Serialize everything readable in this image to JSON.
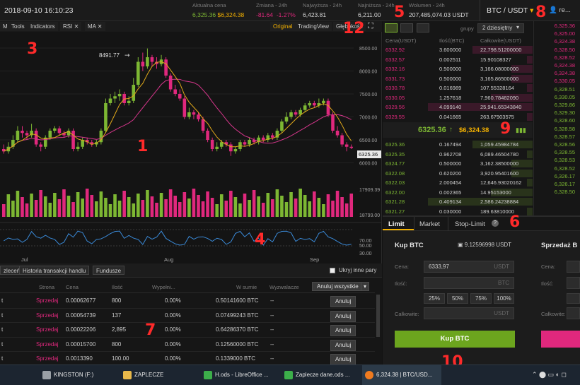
{
  "topbar": {
    "datetime": "2018-09-10 16:10:23",
    "current_price": {
      "label": "Aktualna cena",
      "green": "6,325.36",
      "orange": "$6,324.38"
    },
    "change": {
      "label": "Zmiana - 24h",
      "value": "-81.64",
      "pct": "-1.27%"
    },
    "high": {
      "label": "Najwyższa - 24h",
      "value": "6,423.81"
    },
    "low": {
      "label": "Najniższa - 24h",
      "value": "6,211.00"
    },
    "volume": {
      "label": "Wolumen - 24h",
      "value": "207,485,074.03 USDT"
    },
    "pair": "BTC / USDT",
    "user": "re..."
  },
  "chart_toolbar": {
    "items": [
      "M",
      "Tools",
      "Indicators",
      "RSI",
      "MA"
    ],
    "right": [
      "Original",
      "TradingView",
      "Głębokość"
    ]
  },
  "chart": {
    "peak_label": "8491.77",
    "y_ticks": [
      "8500.00",
      "8000.00",
      "7500.00",
      "7000.00",
      "6500.00",
      "6000.00",
      "17909.39",
      "18799.00"
    ],
    "last_price": "6325.36",
    "rsi_ticks": [
      "70.00",
      "50.00",
      "30.00"
    ],
    "x_ticks": [
      "Jul",
      "Aug",
      "Sep"
    ]
  },
  "chart_data": {
    "type": "candlestick",
    "y_range": [
      5700,
      8700
    ],
    "candles": [
      [
        6300,
        6250,
        6400,
        6200
      ],
      [
        6250,
        6350,
        6450,
        6200
      ],
      [
        6350,
        6500,
        6600,
        6300
      ],
      [
        6500,
        6700,
        6800,
        6450
      ],
      [
        6700,
        6650,
        6800,
        6550
      ],
      [
        6650,
        6600,
        6700,
        6500
      ],
      [
        6600,
        6700,
        6850,
        6550
      ],
      [
        6700,
        6400,
        6750,
        6350
      ],
      [
        6400,
        6350,
        6450,
        6250
      ],
      [
        6350,
        6550,
        6600,
        6300
      ],
      [
        6550,
        6700,
        6750,
        6500
      ],
      [
        6700,
        6750,
        6800,
        6650
      ],
      [
        6750,
        6650,
        6800,
        6600
      ],
      [
        6650,
        6600,
        6700,
        6550
      ],
      [
        6600,
        6700,
        6750,
        6550
      ],
      [
        6700,
        6300,
        6750,
        6250
      ],
      [
        6300,
        6350,
        6450,
        6250
      ],
      [
        6350,
        6500,
        6550,
        6300
      ],
      [
        6500,
        6450,
        6550,
        6400
      ],
      [
        6450,
        6400,
        6500,
        6350
      ],
      [
        6400,
        6450,
        6500,
        6350
      ],
      [
        6450,
        6700,
        6750,
        6400
      ],
      [
        6700,
        7300,
        7400,
        6650
      ],
      [
        7300,
        7400,
        7500,
        7250
      ],
      [
        7400,
        7450,
        7550,
        7300
      ],
      [
        7450,
        7500,
        7600,
        7350
      ],
      [
        7500,
        7300,
        7550,
        7250
      ],
      [
        7300,
        7350,
        7450,
        7250
      ],
      [
        7350,
        7700,
        7850,
        7300
      ],
      [
        7700,
        8200,
        8300,
        7650
      ],
      [
        8200,
        8100,
        8400,
        8000
      ],
      [
        8100,
        8300,
        8491,
        8050
      ],
      [
        8300,
        8200,
        8350,
        8100
      ],
      [
        8200,
        8150,
        8300,
        8050
      ],
      [
        8150,
        8250,
        8350,
        8100
      ],
      [
        8250,
        7900,
        8300,
        7850
      ],
      [
        7900,
        7600,
        7950,
        7550
      ],
      [
        7600,
        7500,
        7700,
        7450
      ],
      [
        7500,
        7400,
        7600,
        7350
      ],
      [
        7400,
        7000,
        7450,
        6950
      ],
      [
        7000,
        7100,
        7200,
        6950
      ],
      [
        7100,
        7050,
        7150,
        6950
      ],
      [
        7050,
        6950,
        7100,
        6900
      ],
      [
        6950,
        6700,
        7000,
        6650
      ],
      [
        6700,
        6500,
        6750,
        6450
      ],
      [
        6500,
        6300,
        6550,
        6250
      ],
      [
        6300,
        6350,
        6450,
        6250
      ],
      [
        6350,
        6450,
        6500,
        6300
      ],
      [
        6450,
        6400,
        6500,
        6350
      ],
      [
        6400,
        6250,
        6450,
        6150
      ],
      [
        6250,
        6300,
        6350,
        6200
      ],
      [
        6300,
        6450,
        6500,
        6250
      ],
      [
        6450,
        6400,
        6500,
        6350
      ],
      [
        6400,
        6500,
        6550,
        6350
      ],
      [
        6500,
        6450,
        6550,
        6400
      ],
      [
        6450,
        6550,
        6600,
        6400
      ],
      [
        6550,
        6500,
        6600,
        6450
      ],
      [
        6500,
        6600,
        6650,
        6450
      ],
      [
        6600,
        6550,
        6650,
        6500
      ],
      [
        6550,
        6700,
        6750,
        6500
      ],
      [
        6700,
        6900,
        6950,
        6650
      ],
      [
        6900,
        7000,
        7100,
        6850
      ],
      [
        7000,
        7100,
        7150,
        6950
      ],
      [
        7100,
        7050,
        7150,
        7000
      ],
      [
        7050,
        7150,
        7200,
        7000
      ],
      [
        7150,
        7250,
        7300,
        7100
      ],
      [
        7250,
        7300,
        7350,
        7200
      ],
      [
        7300,
        7250,
        7350,
        7200
      ],
      [
        7250,
        7300,
        7400,
        7200
      ],
      [
        7300,
        7350,
        7400,
        7250
      ],
      [
        7350,
        7050,
        7400,
        7000
      ],
      [
        7050,
        6700,
        7100,
        6650
      ],
      [
        6700,
        6600,
        6800,
        6550
      ],
      [
        6600,
        6400,
        6650,
        6350
      ],
      [
        6400,
        6350,
        6450,
        6250
      ],
      [
        6350,
        6325,
        6400,
        6300
      ]
    ]
  },
  "orderbook": {
    "group_label": "grupy",
    "group_value": "2 dziesiętny",
    "headers": [
      "Cena(USDT)",
      "Ilość(BTC)",
      "Całkowite(USDT)"
    ],
    "asks": [
      [
        "6332.92",
        "3.600000",
        "22,798.51200000"
      ],
      [
        "6332.57",
        "0.002511",
        "15.90108327"
      ],
      [
        "6332.16",
        "0.500000",
        "3,166.08000000"
      ],
      [
        "6331.73",
        "0.500000",
        "3,165.86500000"
      ],
      [
        "6330.78",
        "0.016989",
        "107.55328164"
      ],
      [
        "6330.05",
        "1.257618",
        "7,960.78482090"
      ],
      [
        "6329.56",
        "4.099140",
        "25,941.65343840"
      ],
      [
        "6329.55",
        "0.041665",
        "263.67903575"
      ]
    ],
    "last_green": "6325.36",
    "last_orange": "$6,324.38",
    "bids": [
      [
        "6325.36",
        "0.167494",
        "1,059.45984784"
      ],
      [
        "6325.35",
        "0.962708",
        "6,089.46504780"
      ],
      [
        "6324.77",
        "0.500000",
        "3,162.38500000"
      ],
      [
        "6322.08",
        "0.620200",
        "3,920.95401600"
      ],
      [
        "6322.03",
        "2.000454",
        "12,646.93020162"
      ],
      [
        "6322.00",
        "0.002365",
        "14.95153000"
      ],
      [
        "6321.28",
        "0.409134",
        "2,586.24238884"
      ],
      [
        "6321.27",
        "0.030000",
        "189.63810000"
      ]
    ]
  },
  "trades": {
    "red": [
      "6,325.36",
      "6,325.00",
      "6,324.38",
      "6,328.50",
      "6,328.52",
      "6,324.38",
      "6,324.38",
      "6,330.05"
    ],
    "green": [
      "6,328.51",
      "6,330.05",
      "6,329.86",
      "6,329.30",
      "6,328.60",
      "6,328.58",
      "6,328.57",
      "6,328.56",
      "6,328.55",
      "6,328.53",
      "6,328.52",
      "6,326.17",
      "6,326.17",
      "6,328.50"
    ]
  },
  "orders": {
    "tabs": [
      "zleceń",
      "Historia transakcji handlu",
      "Fundusze"
    ],
    "hide_label": "Ukryj inne pary",
    "headers": [
      "Strona",
      "Cena",
      "Ilość",
      "Wypełni...",
      "W sumie",
      "Wyzwalacze"
    ],
    "cancel_all": "Anuluj wszystkie",
    "rows": [
      [
        "t",
        "Sprzedaj",
        "0.00062677",
        "800",
        "0.00%",
        "0.50141600 BTC",
        "--"
      ],
      [
        "t",
        "Sprzedaj",
        "0.00054739",
        "137",
        "0.00%",
        "0.07499243 BTC",
        "--"
      ],
      [
        "t",
        "Sprzedaj",
        "0.00022206",
        "2,895",
        "0.00%",
        "0.64286370 BTC",
        "--"
      ],
      [
        "t",
        "Sprzedaj",
        "0.00015700",
        "800",
        "0.00%",
        "0.12560000 BTC",
        "--"
      ],
      [
        "t",
        "Sprzedaj",
        "0.0013390",
        "100.00",
        "0.00%",
        "0.1339000 BTC",
        "--"
      ]
    ],
    "cancel": "Anuluj"
  },
  "form": {
    "tabs": [
      "Limit",
      "Market",
      "Stop-Limit"
    ],
    "buy_title": "Kup BTC",
    "balance": "9.12596998 USDT",
    "sell_title": "Sprzedaż B",
    "price_label": "Cena:",
    "price_value": "6333,97",
    "unit_usdt": "USDT",
    "qty_label": "Ilość:",
    "unit_btc": "BTC",
    "pcts": [
      "25%",
      "50%",
      "75%",
      "100%"
    ],
    "total_label": "Całkowite:",
    "buy_button": "Kup BTC"
  },
  "annotations": [
    "1",
    "3",
    "4",
    "5",
    "6",
    "7",
    "8",
    "9",
    "10",
    "12"
  ],
  "taskbar": [
    "KINGSTON (F:)",
    "ZAPLECZE",
    "H.ods - LibreOffice ...",
    "Zaplecze dane.ods ...",
    "6,324.38 | BTC/USD..."
  ]
}
